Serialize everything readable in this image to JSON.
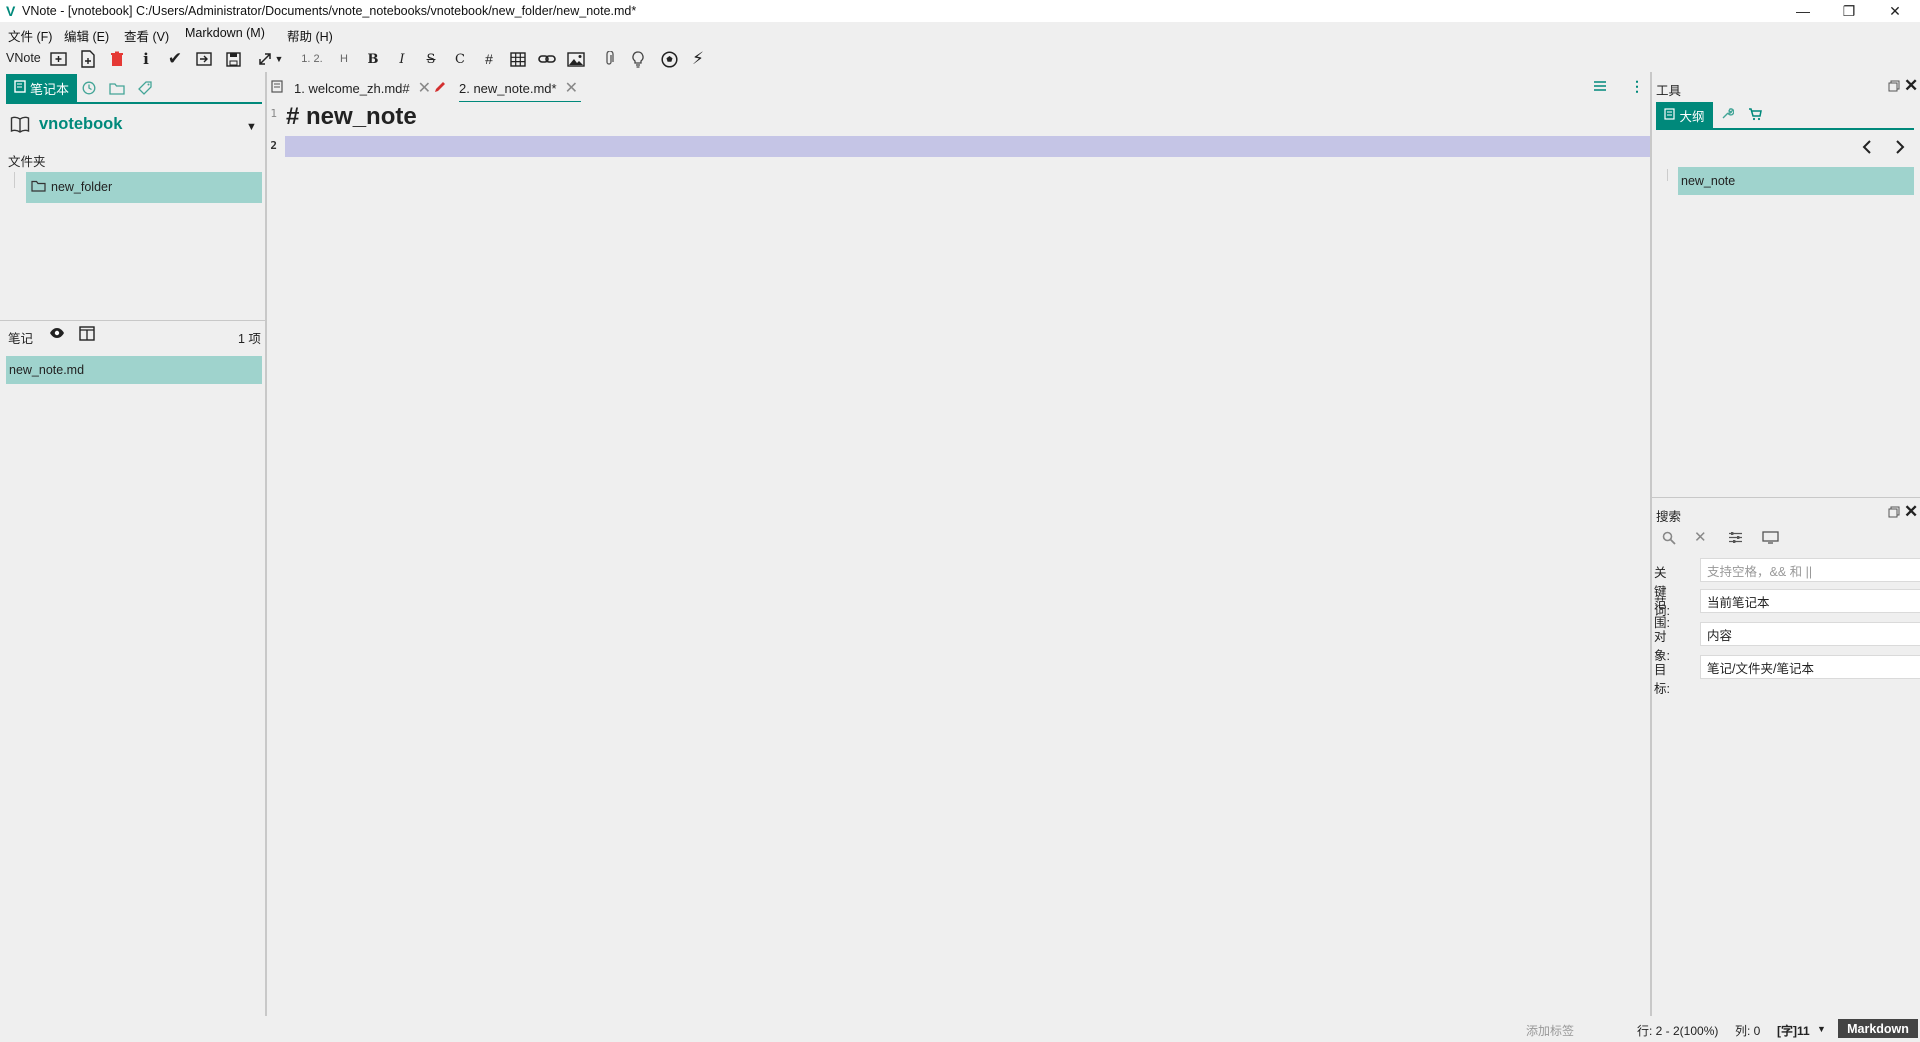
{
  "window": {
    "title": "VNote - [vnotebook] C:/Users/Administrator/Documents/vnote_notebooks/vnotebook/new_folder/new_note.md*"
  },
  "menu": [
    "文件 (F)",
    "编辑 (E)",
    "查看 (V)",
    "Markdown (M)",
    "帮助 (H)"
  ],
  "toolbar": {
    "app_label": "VNote",
    "ordered_list": "1. 2.",
    "heading": "H",
    "bold": "B",
    "italic": "I",
    "strike": "S",
    "code": "C",
    "hash": "#"
  },
  "left": {
    "notebook_tab": "笔记本",
    "notebook_name": "vnotebook",
    "folders_label": "文件夹",
    "folders": [
      "new_folder"
    ],
    "notes_label": "笔记",
    "notes_count": "1 项",
    "notes": [
      "new_note.md"
    ]
  },
  "tabs": [
    {
      "label": "1. welcome_zh.md#",
      "active": false
    },
    {
      "label": "2. new_note.md*",
      "active": true
    }
  ],
  "editor": {
    "lines": [
      {
        "num": "1",
        "text": "# new_note"
      },
      {
        "num": "2",
        "text": ""
      }
    ]
  },
  "tools": {
    "title": "工具",
    "outline_tab": "大纲",
    "outline_items": [
      "new_note"
    ]
  },
  "search": {
    "title": "搜索",
    "fields": [
      {
        "label": "关键词:",
        "value": "",
        "placeholder": "支持空格，&& 和 ||"
      },
      {
        "label": "范围:",
        "value": "当前笔记本",
        "placeholder": ""
      },
      {
        "label": "对象:",
        "value": "内容",
        "placeholder": ""
      },
      {
        "label": "目标:",
        "value": "笔记/文件夹/笔记本",
        "placeholder": ""
      }
    ]
  },
  "status": {
    "add_tag": "添加标签",
    "position": "行: 2 - 2(100%)",
    "column": "列: 0",
    "word_count": "[字]11",
    "mode": "Markdown"
  },
  "colors": {
    "accent": "#00897b",
    "selection": "#9fd3cd",
    "current_line": "#c5c5e6",
    "background": "#efefef"
  }
}
